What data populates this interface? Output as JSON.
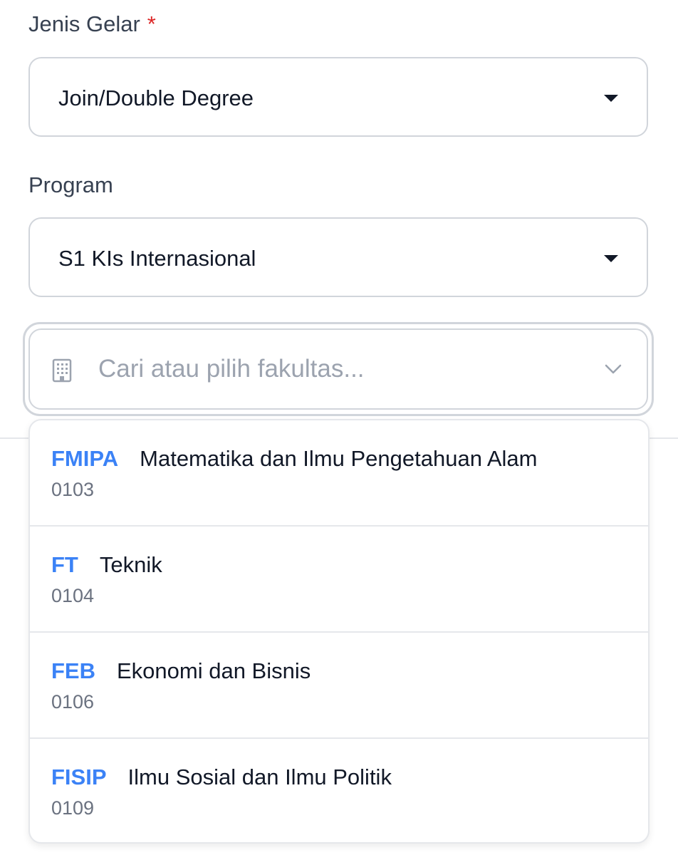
{
  "degree_type": {
    "label": "Jenis Gelar",
    "required_mark": "*",
    "selected": "Join/Double Degree"
  },
  "program": {
    "label": "Program",
    "selected": "S1 KIs Internasional"
  },
  "faculty": {
    "placeholder": "Cari atau pilih fakultas...",
    "icon": "building-icon",
    "options": [
      {
        "code": "FMIPA",
        "name": "Matematika dan Ilmu Pengetahuan Alam",
        "id": "0103"
      },
      {
        "code": "FT",
        "name": "Teknik",
        "id": "0104"
      },
      {
        "code": "FEB",
        "name": "Ekonomi dan Bisnis",
        "id": "0106"
      },
      {
        "code": "FISIP",
        "name": "Ilmu Sosial dan Ilmu Politik",
        "id": "0109"
      }
    ]
  },
  "colors": {
    "accent": "#3b82f6",
    "required": "#dc2626",
    "border": "#d1d5db"
  }
}
